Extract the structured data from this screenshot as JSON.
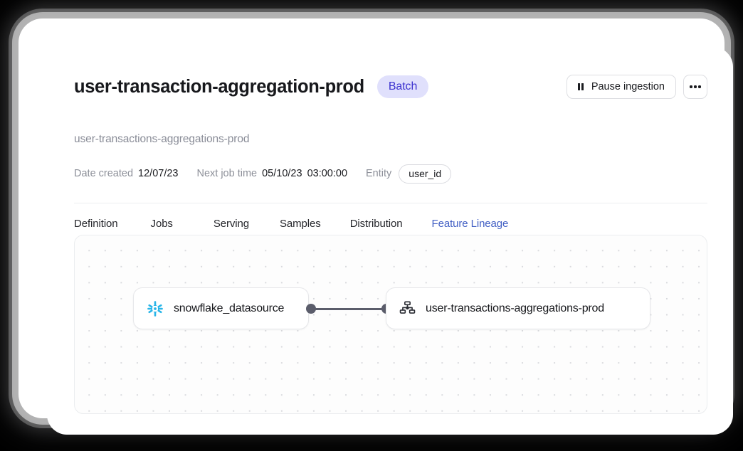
{
  "header": {
    "title": "user-transaction-aggregation-prod",
    "badge": "Batch",
    "subtitle": "user-transactions-aggregations-prod",
    "pause_button": "Pause ingestion",
    "pause_icon": "pause-icon",
    "more_icon": "ellipsis-icon"
  },
  "meta": {
    "date_created_label": "Date created",
    "date_created_value": "12/07/23",
    "next_job_label": "Next job time",
    "next_job_date": "05/10/23",
    "next_job_hour": "03:00:00",
    "entity_label": "Entity",
    "entity_value": "user_id"
  },
  "tabs": [
    {
      "label": "Definition",
      "active": false
    },
    {
      "label": "Jobs",
      "active": false
    },
    {
      "label": "Serving",
      "active": false
    },
    {
      "label": "Samples",
      "active": false
    },
    {
      "label": "Distribution",
      "active": false
    },
    {
      "label": "Feature Lineage",
      "active": true
    }
  ],
  "lineage": {
    "source_node": {
      "label": "snowflake_datasource",
      "icon": "snowflake-icon"
    },
    "target_node": {
      "label": "user-transactions-aggregations-prod",
      "icon": "sitemap-icon"
    },
    "edge": "source-to-target-edge"
  },
  "colors": {
    "accent": "#4360c4",
    "badge_bg": "#e0e0fc",
    "badge_text": "#3c32cf",
    "snowflake": "#29b5e8",
    "edge": "#5b5d6b"
  }
}
